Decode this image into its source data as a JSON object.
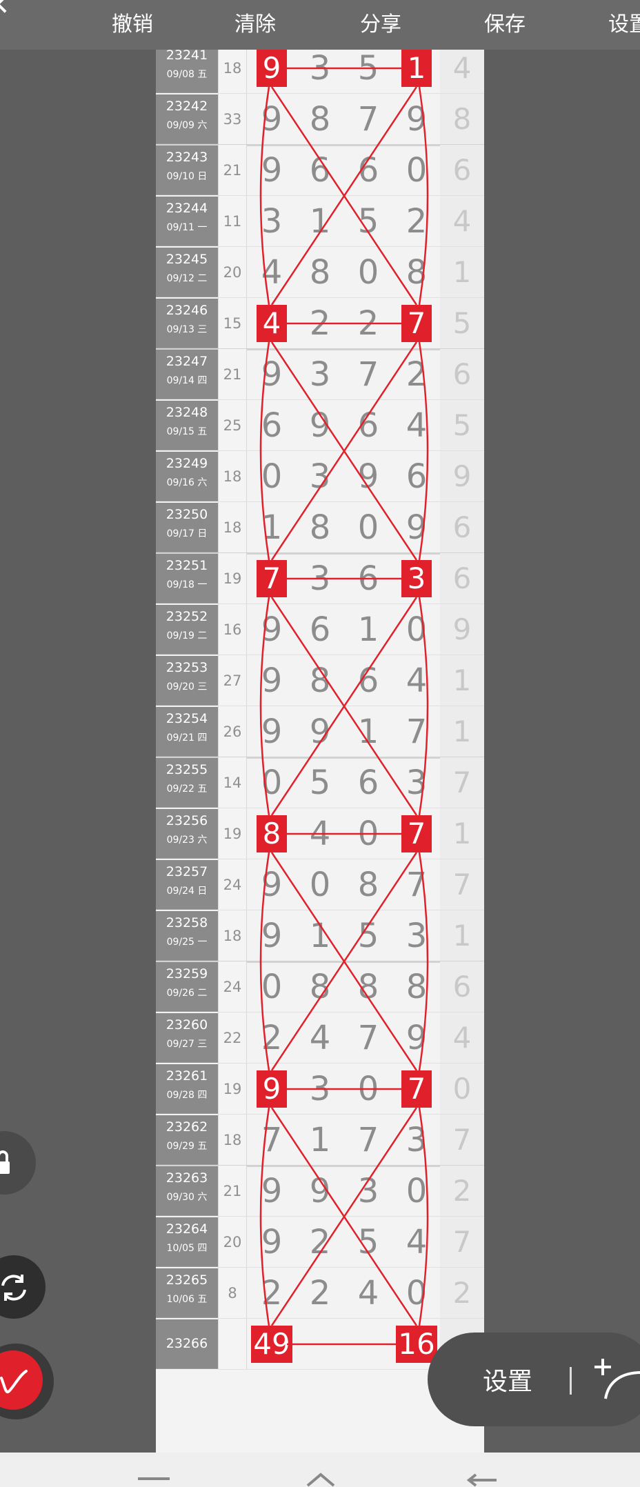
{
  "toolbar": {
    "undo_label": "撤销",
    "clear_label": "清除",
    "share_label": "分享",
    "save_label": "保存",
    "settings_label": "设置"
  },
  "rows": [
    {
      "issue": "23241",
      "date": "09/08 五",
      "sum": "18",
      "digits": [
        "9",
        "3",
        "5",
        "1"
      ],
      "extra": "4",
      "hl": [
        0,
        3
      ]
    },
    {
      "issue": "23242",
      "date": "09/09 六",
      "sum": "33",
      "digits": [
        "9",
        "8",
        "7",
        "9"
      ],
      "extra": "8",
      "hl": []
    },
    {
      "issue": "23243",
      "date": "09/10 日",
      "sum": "21",
      "digits": [
        "9",
        "6",
        "6",
        "0"
      ],
      "extra": "6",
      "hl": []
    },
    {
      "issue": "23244",
      "date": "09/11 一",
      "sum": "11",
      "digits": [
        "3",
        "1",
        "5",
        "2"
      ],
      "extra": "4",
      "hl": []
    },
    {
      "issue": "23245",
      "date": "09/12 二",
      "sum": "20",
      "digits": [
        "4",
        "8",
        "0",
        "8"
      ],
      "extra": "1",
      "hl": []
    },
    {
      "issue": "23246",
      "date": "09/13 三",
      "sum": "15",
      "digits": [
        "4",
        "2",
        "2",
        "7"
      ],
      "extra": "5",
      "hl": [
        0,
        3
      ]
    },
    {
      "issue": "23247",
      "date": "09/14 四",
      "sum": "21",
      "digits": [
        "9",
        "3",
        "7",
        "2"
      ],
      "extra": "6",
      "hl": []
    },
    {
      "issue": "23248",
      "date": "09/15 五",
      "sum": "25",
      "digits": [
        "6",
        "9",
        "6",
        "4"
      ],
      "extra": "5",
      "hl": []
    },
    {
      "issue": "23249",
      "date": "09/16 六",
      "sum": "18",
      "digits": [
        "0",
        "3",
        "9",
        "6"
      ],
      "extra": "9",
      "hl": []
    },
    {
      "issue": "23250",
      "date": "09/17 日",
      "sum": "18",
      "digits": [
        "1",
        "8",
        "0",
        "9"
      ],
      "extra": "6",
      "hl": []
    },
    {
      "issue": "23251",
      "date": "09/18 一",
      "sum": "19",
      "digits": [
        "7",
        "3",
        "6",
        "3"
      ],
      "extra": "6",
      "hl": [
        0,
        3
      ]
    },
    {
      "issue": "23252",
      "date": "09/19 二",
      "sum": "16",
      "digits": [
        "9",
        "6",
        "1",
        "0"
      ],
      "extra": "9",
      "hl": []
    },
    {
      "issue": "23253",
      "date": "09/20 三",
      "sum": "27",
      "digits": [
        "9",
        "8",
        "6",
        "4"
      ],
      "extra": "1",
      "hl": []
    },
    {
      "issue": "23254",
      "date": "09/21 四",
      "sum": "26",
      "digits": [
        "9",
        "9",
        "1",
        "7"
      ],
      "extra": "1",
      "hl": []
    },
    {
      "issue": "23255",
      "date": "09/22 五",
      "sum": "14",
      "digits": [
        "0",
        "5",
        "6",
        "3"
      ],
      "extra": "7",
      "hl": []
    },
    {
      "issue": "23256",
      "date": "09/23 六",
      "sum": "19",
      "digits": [
        "8",
        "4",
        "0",
        "7"
      ],
      "extra": "1",
      "hl": [
        0,
        3
      ]
    },
    {
      "issue": "23257",
      "date": "09/24 日",
      "sum": "24",
      "digits": [
        "9",
        "0",
        "8",
        "7"
      ],
      "extra": "7",
      "hl": []
    },
    {
      "issue": "23258",
      "date": "09/25 一",
      "sum": "18",
      "digits": [
        "9",
        "1",
        "5",
        "3"
      ],
      "extra": "1",
      "hl": []
    },
    {
      "issue": "23259",
      "date": "09/26 二",
      "sum": "24",
      "digits": [
        "0",
        "8",
        "8",
        "8"
      ],
      "extra": "6",
      "hl": []
    },
    {
      "issue": "23260",
      "date": "09/27 三",
      "sum": "22",
      "digits": [
        "2",
        "4",
        "7",
        "9"
      ],
      "extra": "4",
      "hl": []
    },
    {
      "issue": "23261",
      "date": "09/28 四",
      "sum": "19",
      "digits": [
        "9",
        "3",
        "0",
        "7"
      ],
      "extra": "0",
      "hl": [
        0,
        3
      ]
    },
    {
      "issue": "23262",
      "date": "09/29 五",
      "sum": "18",
      "digits": [
        "7",
        "1",
        "7",
        "3"
      ],
      "extra": "7",
      "hl": []
    },
    {
      "issue": "23263",
      "date": "09/30 六",
      "sum": "21",
      "digits": [
        "9",
        "9",
        "3",
        "0"
      ],
      "extra": "2",
      "hl": []
    },
    {
      "issue": "23264",
      "date": "10/05 四",
      "sum": "20",
      "digits": [
        "9",
        "2",
        "5",
        "4"
      ],
      "extra": "7",
      "hl": []
    },
    {
      "issue": "23265",
      "date": "10/06 五",
      "sum": "8",
      "digits": [
        "2",
        "2",
        "4",
        "0"
      ],
      "extra": "2",
      "hl": []
    },
    {
      "issue": "23266",
      "date": "",
      "sum": "",
      "digits": [
        "49",
        "",
        "",
        "16"
      ],
      "extra": "",
      "hl": [
        0,
        3
      ]
    }
  ],
  "float_panel": {
    "settings_label": "设置"
  },
  "colors": {
    "accent": "#e0202a",
    "toolbar": "#6a6a6a",
    "issue_bg": "#8a8a8a"
  },
  "icons": [
    "back-icon",
    "lock-icon",
    "rotate-icon",
    "pen-icon",
    "curve-tool-icon",
    "nav-menu-icon",
    "nav-home-icon",
    "nav-back-icon"
  ]
}
